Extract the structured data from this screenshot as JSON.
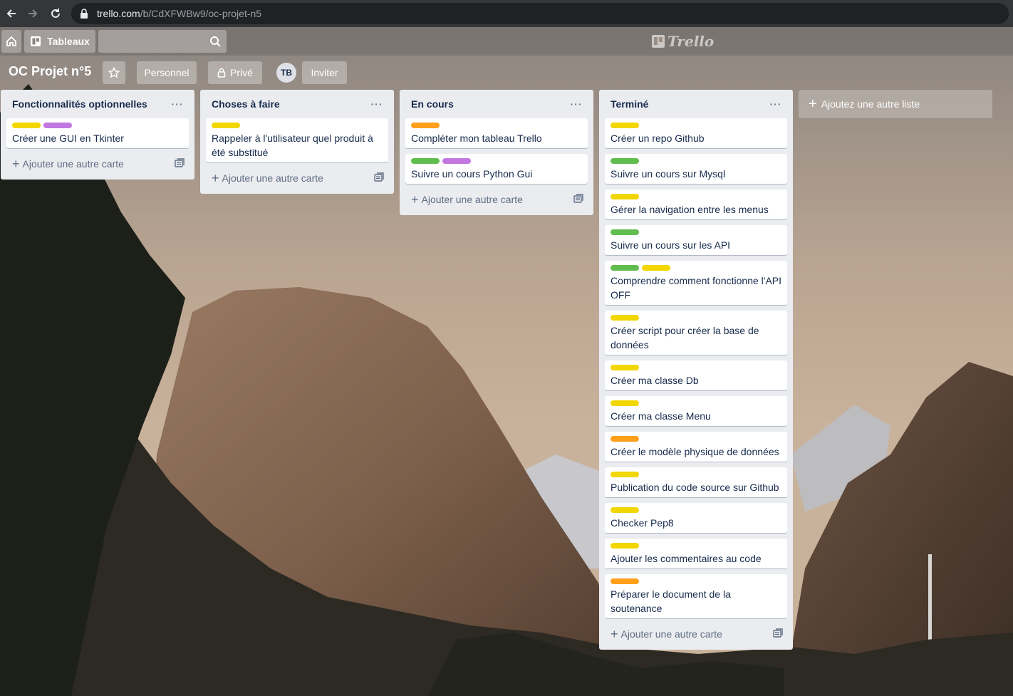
{
  "browser": {
    "url_host": "trello.com",
    "url_path": "/b/CdXFWBw9/oc-projet-n5"
  },
  "header": {
    "boards_label": "Tableaux",
    "logo_text": "Trello"
  },
  "board": {
    "title": "OC Projet n°5",
    "personal_label": "Personnel",
    "private_label": "Privé",
    "avatar_initials": "TB",
    "invite_label": "Inviter"
  },
  "colors": {
    "yellow": "#f2d600",
    "purple": "#c377e0",
    "green": "#61bd4f",
    "orange": "#ff9f1a"
  },
  "add_card_label": "Ajouter une autre carte",
  "add_list_label": "Ajoutez une autre liste",
  "lists": [
    {
      "title": "Fonctionnalités optionnelles",
      "cards": [
        {
          "labels": [
            "#f2d600",
            "#c377e0"
          ],
          "title": "Créer une GUI en Tkinter"
        }
      ]
    },
    {
      "title": "Choses à faire",
      "cards": [
        {
          "labels": [
            "#f2d600"
          ],
          "title": "Rappeler à l'utilisateur quel produit à été substitué"
        }
      ]
    },
    {
      "title": "En cours",
      "cards": [
        {
          "labels": [
            "#ff9f1a"
          ],
          "title": "Compléter mon tableau Trello"
        },
        {
          "labels": [
            "#61bd4f",
            "#c377e0"
          ],
          "title": "Suivre un cours Python Gui"
        }
      ]
    },
    {
      "title": "Terminé",
      "cards": [
        {
          "labels": [
            "#f2d600"
          ],
          "title": "Créer un repo Github"
        },
        {
          "labels": [
            "#61bd4f"
          ],
          "title": "Suivre un cours sur Mysql"
        },
        {
          "labels": [
            "#f2d600"
          ],
          "title": "Gérer la navigation entre les menus"
        },
        {
          "labels": [
            "#61bd4f"
          ],
          "title": "Suivre un cours sur les API"
        },
        {
          "labels": [
            "#61bd4f",
            "#f2d600"
          ],
          "title": "Comprendre comment fonctionne l'API OFF"
        },
        {
          "labels": [
            "#f2d600"
          ],
          "title": "Créer script pour créer la base de données"
        },
        {
          "labels": [
            "#f2d600"
          ],
          "title": "Créer ma classe Db"
        },
        {
          "labels": [
            "#f2d600"
          ],
          "title": "Créer ma classe Menu"
        },
        {
          "labels": [
            "#ff9f1a"
          ],
          "title": "Créer le modèle physique de données"
        },
        {
          "labels": [
            "#f2d600"
          ],
          "title": "Publication du code source sur Github"
        },
        {
          "labels": [
            "#f2d600"
          ],
          "title": "Checker Pep8"
        },
        {
          "labels": [
            "#f2d600"
          ],
          "title": "Ajouter les commentaires au code"
        },
        {
          "labels": [
            "#ff9f1a"
          ],
          "title": "Préparer le document de la soutenance"
        }
      ]
    }
  ]
}
